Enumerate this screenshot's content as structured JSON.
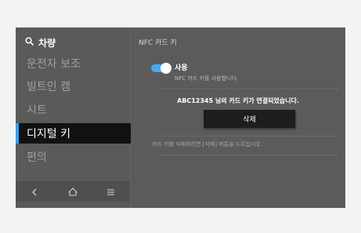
{
  "sidebar": {
    "header": {
      "icon": "search-icon",
      "label": "차량"
    },
    "items": [
      {
        "label": "운전자 보조",
        "active": false
      },
      {
        "label": "빌트인 캠",
        "active": false
      },
      {
        "label": "시트",
        "active": false
      },
      {
        "label": "디지털 키",
        "active": true
      },
      {
        "label": "편의",
        "active": false
      }
    ],
    "nav": [
      "back-icon",
      "home-icon",
      "menu-icon"
    ]
  },
  "content": {
    "title": "NFC 카드 키",
    "toggle": {
      "label": "사용",
      "description": "NFC 카드 키를 사용합니다.",
      "on": true
    },
    "linked_message": "ABC12345 님의 카드 키가 연결되었습니다.",
    "delete_label": "삭제",
    "hint": "카드 키를 삭제하려면 [삭제] 버튼을 누르십시오."
  },
  "colors": {
    "accent": "#2ba4ff",
    "toggle": "#4aa8f0",
    "screen_bg": "#5b5b5b",
    "active_bg": "#111111"
  }
}
